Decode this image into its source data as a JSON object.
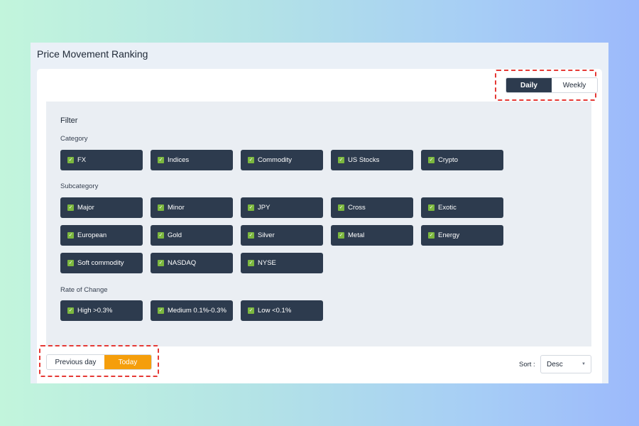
{
  "page": {
    "title": "Price Movement Ranking"
  },
  "period_toggle": {
    "options": [
      "Daily",
      "Weekly"
    ],
    "selected": "Daily"
  },
  "filter": {
    "title": "Filter",
    "category": {
      "label": "Category",
      "chips": [
        "FX",
        "Indices",
        "Commodity",
        "US Stocks",
        "Crypto"
      ]
    },
    "subcategory": {
      "label": "Subcategory",
      "chips": [
        "Major",
        "Minor",
        "JPY",
        "Cross",
        "Exotic",
        "European",
        "Gold",
        "Silver",
        "Metal",
        "Energy",
        "Soft commodity",
        "NASDAQ",
        "NYSE"
      ]
    },
    "rate_of_change": {
      "label": "Rate of Change",
      "chips": [
        "High >0.3%",
        "Medium 0.1%-0.3%",
        "Low <0.1%"
      ]
    }
  },
  "day_toggle": {
    "options": [
      "Previous day",
      "Today"
    ],
    "selected": "Today"
  },
  "sort": {
    "label": "Sort :",
    "value": "Desc"
  },
  "colors": {
    "chip_bg": "#2d3b4e",
    "checkbox": "#7cb83e",
    "accent_orange": "#f59e0b",
    "highlight_border": "#e53935"
  },
  "icons": {
    "checkbox": "check-icon",
    "select": "chevron-down-icon"
  }
}
